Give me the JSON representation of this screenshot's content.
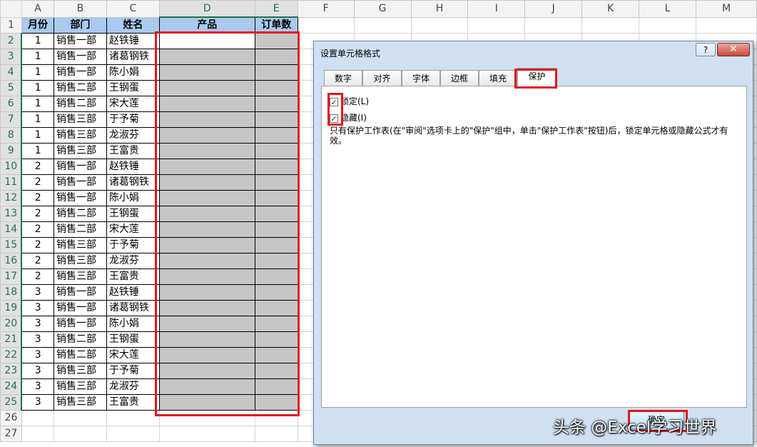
{
  "columns": [
    "A",
    "B",
    "C",
    "D",
    "E",
    "F",
    "G",
    "H",
    "I",
    "J",
    "K",
    "L",
    "M"
  ],
  "rows": [
    "1",
    "2",
    "3",
    "4",
    "5",
    "6",
    "7",
    "8",
    "9",
    "10",
    "11",
    "12",
    "13",
    "14",
    "15",
    "16",
    "17",
    "18",
    "19",
    "20",
    "21",
    "22",
    "23",
    "24",
    "25",
    "26",
    "27"
  ],
  "headers": [
    "月份",
    "部门",
    "姓名",
    "产品",
    "订单数"
  ],
  "records": [
    [
      "1",
      "销售一部",
      "赵铁锤"
    ],
    [
      "1",
      "销售一部",
      "诸葛钢铁"
    ],
    [
      "1",
      "销售一部",
      "陈小娟"
    ],
    [
      "1",
      "销售二部",
      "王钢蛋"
    ],
    [
      "1",
      "销售二部",
      "宋大莲"
    ],
    [
      "1",
      "销售三部",
      "于予菊"
    ],
    [
      "1",
      "销售三部",
      "龙淑芬"
    ],
    [
      "1",
      "销售三部",
      "王富贵"
    ],
    [
      "2",
      "销售一部",
      "赵铁锤"
    ],
    [
      "2",
      "销售一部",
      "诸葛钢铁"
    ],
    [
      "2",
      "销售一部",
      "陈小娟"
    ],
    [
      "2",
      "销售二部",
      "王钢蛋"
    ],
    [
      "2",
      "销售二部",
      "宋大莲"
    ],
    [
      "2",
      "销售三部",
      "于予菊"
    ],
    [
      "2",
      "销售三部",
      "龙淑芬"
    ],
    [
      "2",
      "销售三部",
      "王富贵"
    ],
    [
      "3",
      "销售一部",
      "赵铁锤"
    ],
    [
      "3",
      "销售一部",
      "诸葛钢铁"
    ],
    [
      "3",
      "销售一部",
      "陈小娟"
    ],
    [
      "3",
      "销售二部",
      "王钢蛋"
    ],
    [
      "3",
      "销售二部",
      "宋大莲"
    ],
    [
      "3",
      "销售三部",
      "于予菊"
    ],
    [
      "3",
      "销售三部",
      "龙淑芬"
    ],
    [
      "3",
      "销售三部",
      "王富贵"
    ]
  ],
  "dialog": {
    "title": "设置单元格格式",
    "help": "?",
    "close": "✕",
    "tabs": [
      "数字",
      "对齐",
      "字体",
      "边框",
      "填充",
      "保护"
    ],
    "active_tab": "保护",
    "locked_label": "锁定(L)",
    "locked_checked": true,
    "hidden_label": "隐藏(I)",
    "hidden_checked": true,
    "note": "只有保护工作表(在\"审阅\"选项卡上的\"保护\"组中，单击\"保护工作表\"按钮)后，锁定单元格或隐藏公式才有效。",
    "ok_label": "确定"
  },
  "watermark": "头条 @Excel学习世界",
  "colors": {
    "header_fill": "#a9c9ee",
    "selected_fill": "#c6c6c6",
    "highlight": "#e0141e",
    "excel_green": "#217346"
  }
}
